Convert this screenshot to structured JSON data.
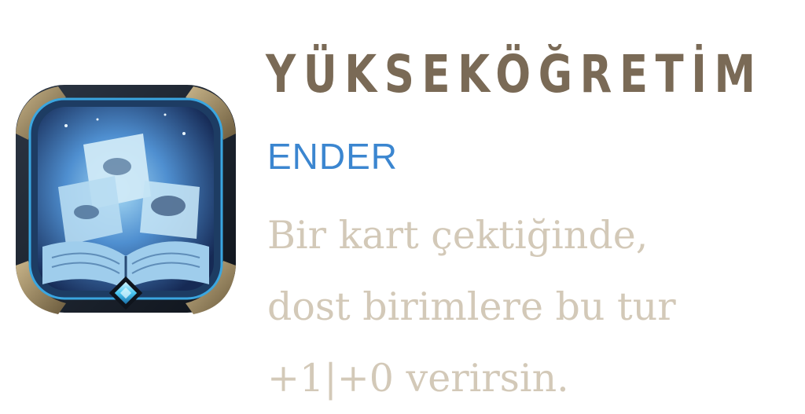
{
  "keyword": {
    "title": "YÜKSEKÖĞRETİM",
    "rarity": "ENDER",
    "description_lines": [
      "Bir kart çektiğinde,",
      "dost birimlere bu tur",
      "+1|+0 verirsin."
    ],
    "icon": "open-book-art-icon",
    "gem_icon": "blue-diamond-gem-icon"
  },
  "colors": {
    "title": "#7a6a56",
    "rarity": "#3b86d0",
    "description": "#d3c9b8",
    "frame_dark": "#1b2430",
    "frame_gold": "#8a7650",
    "art_blue": "#6fb3e4",
    "gem": "#49c7f2"
  }
}
